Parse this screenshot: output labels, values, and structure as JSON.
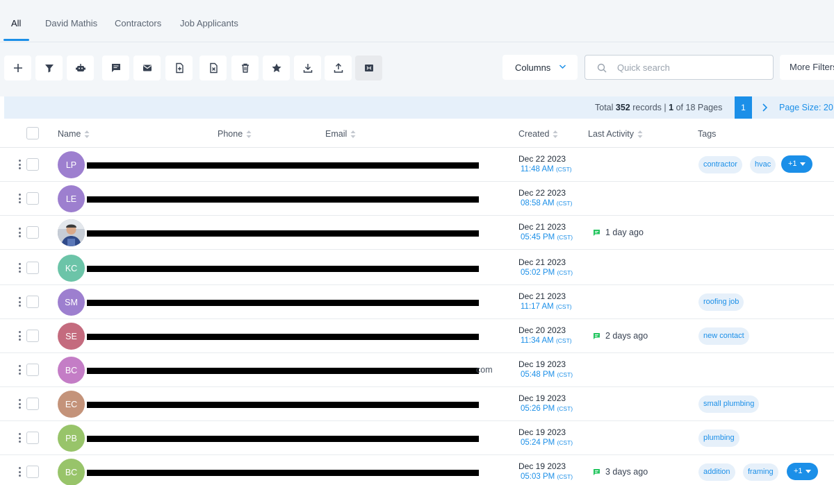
{
  "tabs": [
    {
      "label": "All",
      "active": true
    },
    {
      "label": "David Mathis",
      "active": false
    },
    {
      "label": "Contractors",
      "active": false
    },
    {
      "label": "Job Applicants",
      "active": false
    }
  ],
  "toolbar": {
    "icons": [
      "add-icon",
      "filter-icon",
      "bot-icon",
      "message-icon",
      "mail-icon",
      "tag-add-icon",
      "tag-remove-icon",
      "trash-icon",
      "star-icon",
      "download-icon",
      "upload-icon",
      "merge-icon"
    ],
    "columns_label": "Columns",
    "search_placeholder": "Quick search",
    "more_filters_label": "More Filters"
  },
  "pagination": {
    "total_prefix": "Total",
    "total_records": "352",
    "records_word": "records",
    "separator": "|",
    "current_page": "1",
    "of_word": "of",
    "total_pages": "18",
    "pages_word": "Pages",
    "page_size_label": "Page Size: 20"
  },
  "table": {
    "headers": {
      "name": "Name",
      "phone": "Phone",
      "email": "Email",
      "created": "Created",
      "last_activity": "Last Activity",
      "tags": "Tags"
    },
    "rows": [
      {
        "initials": "LP",
        "avatar_color": "#9d7fcf",
        "date": "Dec 22 2023",
        "time": "11:48 AM",
        "tz": "(CST)",
        "activity": "",
        "tags": [
          "contractor",
          "hvac"
        ],
        "more": "+1"
      },
      {
        "initials": "LE",
        "avatar_color": "#9d7fcf",
        "date": "Dec 22 2023",
        "time": "08:58 AM",
        "tz": "(CST)",
        "activity": "",
        "tags": [],
        "more": ""
      },
      {
        "initials": "",
        "avatar_color": "#5d6b86",
        "photo": true,
        "date": "Dec 21 2023",
        "time": "05:45 PM",
        "tz": "(CST)",
        "activity": "1 day ago",
        "tags": [],
        "more": ""
      },
      {
        "initials": "KC",
        "avatar_color": "#6cc4a8",
        "date": "Dec 21 2023",
        "time": "05:02 PM",
        "tz": "(CST)",
        "activity": "",
        "tags": [],
        "more": ""
      },
      {
        "initials": "SM",
        "avatar_color": "#9d7fcf",
        "date": "Dec 21 2023",
        "time": "11:17 AM",
        "tz": "(CST)",
        "activity": "",
        "tags": [
          "roofing job"
        ],
        "more": ""
      },
      {
        "initials": "SE",
        "avatar_color": "#c46b7e",
        "date": "Dec 20 2023",
        "time": "11:34 AM",
        "tz": "(CST)",
        "activity": "2 days ago",
        "tags": [
          "new contact"
        ],
        "more": ""
      },
      {
        "initials": "BC",
        "avatar_color": "#c47dc6",
        "date": "Dec 19 2023",
        "time": "05:48 PM",
        "tz": "(CST)",
        "activity": "",
        "tags": [],
        "more": "",
        "email_tail": "com"
      },
      {
        "initials": "EC",
        "avatar_color": "#c4937a",
        "date": "Dec 19 2023",
        "time": "05:26 PM",
        "tz": "(CST)",
        "activity": "",
        "tags": [
          "small plumbing"
        ],
        "more": ""
      },
      {
        "initials": "PB",
        "avatar_color": "#98c46a",
        "date": "Dec 19 2023",
        "time": "05:24 PM",
        "tz": "(CST)",
        "activity": "",
        "tags": [
          "plumbing"
        ],
        "more": ""
      },
      {
        "initials": "BC",
        "avatar_color": "#98c46a",
        "date": "Dec 19 2023",
        "time": "05:03 PM",
        "tz": "(CST)",
        "activity": "3 days ago",
        "tags": [
          "addition",
          "framing"
        ],
        "more": "+1"
      }
    ]
  },
  "colors": {
    "accent": "#1b8fe8",
    "tag_bg": "#e6f0fa",
    "activity_icon": "#22c55e"
  }
}
